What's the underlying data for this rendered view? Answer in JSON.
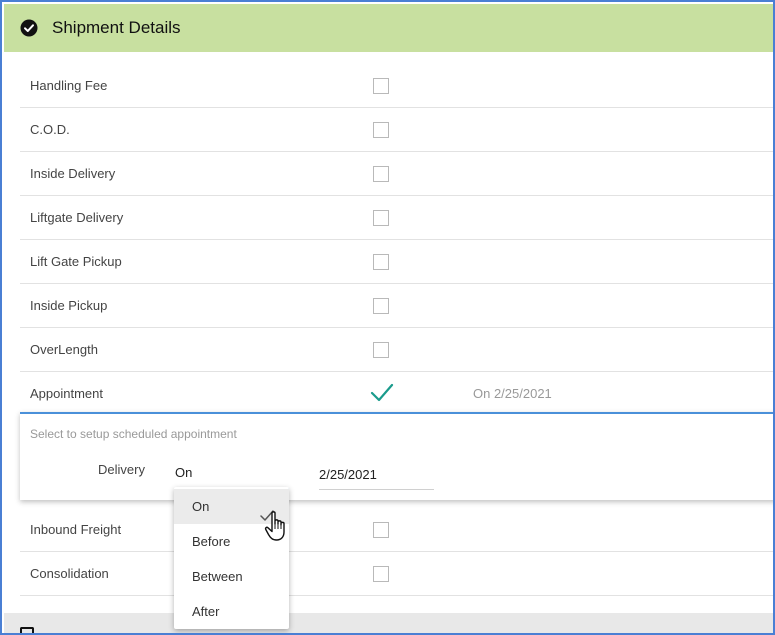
{
  "header": {
    "title": "Shipment Details",
    "icon": "check-circle-icon",
    "accent": "#c8e0a0"
  },
  "rows_top": [
    {
      "label": "Handling Fee",
      "checked": false
    },
    {
      "label": "C.O.D.",
      "checked": false
    },
    {
      "label": "Inside Delivery",
      "checked": false
    },
    {
      "label": "Liftgate Delivery",
      "checked": false
    },
    {
      "label": "Lift Gate Pickup",
      "checked": false
    },
    {
      "label": "Inside Pickup",
      "checked": false
    },
    {
      "label": "OverLength",
      "checked": false
    },
    {
      "label": "Appointment",
      "checked": true,
      "status": "On 2/25/2021"
    }
  ],
  "appointment": {
    "hint": "Select to setup scheduled appointment",
    "field_label": "Delivery",
    "mode": "On",
    "date": "2/25/2021"
  },
  "dropdown": {
    "options": [
      "On",
      "Before",
      "Between",
      "After"
    ],
    "selected": "On"
  },
  "rows_bottom": [
    {
      "label": "Inbound Freight",
      "checked": false
    },
    {
      "label": "Consolidation",
      "checked": false
    }
  ],
  "colors": {
    "tick": "#1a9b8c",
    "select_underline": "#2b7fc9",
    "frame": "#4a7fd4"
  }
}
